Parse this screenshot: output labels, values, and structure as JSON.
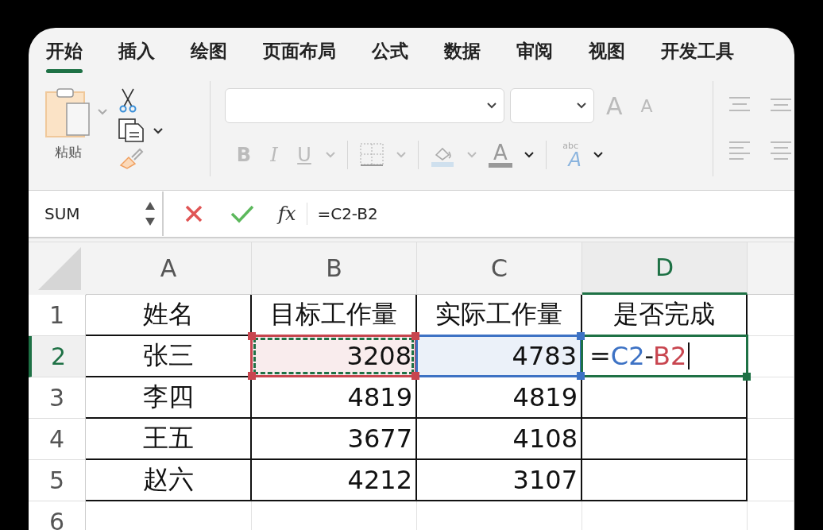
{
  "tabs": [
    {
      "label": "开始",
      "selected": true
    },
    {
      "label": "插入",
      "selected": false
    },
    {
      "label": "绘图",
      "selected": false
    },
    {
      "label": "页面布局",
      "selected": false
    },
    {
      "label": "公式",
      "selected": false
    },
    {
      "label": "数据",
      "selected": false
    },
    {
      "label": "审阅",
      "selected": false
    },
    {
      "label": "视图",
      "selected": false
    },
    {
      "label": "开发工具",
      "selected": false
    }
  ],
  "clipboard": {
    "paste_label": "粘贴"
  },
  "font_buttons": [
    {
      "kind": "bold",
      "glyph": "B"
    },
    {
      "kind": "italic",
      "glyph": "I"
    },
    {
      "kind": "underline",
      "glyph": "U"
    }
  ],
  "font_color": {
    "glyph": "A"
  },
  "text_effects": {
    "small": "abc",
    "glyph": "A"
  },
  "grow_shrink": [
    {
      "glyph": "A",
      "kind": "grow"
    },
    {
      "glyph": "A",
      "kind": "shrink"
    }
  ],
  "formula_bar": {
    "name_box": "SUM",
    "fx": "fx",
    "formula": "=C2-B2"
  },
  "columns": [
    {
      "label": "A",
      "selected": false
    },
    {
      "label": "B",
      "selected": false
    },
    {
      "label": "C",
      "selected": false
    },
    {
      "label": "D",
      "selected": true
    }
  ],
  "rows": [
    {
      "number": "1",
      "selected": false,
      "cells": [
        {
          "text": "姓名",
          "kind": "label"
        },
        {
          "text": "目标工作量",
          "kind": "label"
        },
        {
          "text": "实际工作量",
          "kind": "label"
        },
        {
          "text": "是否完成",
          "kind": "label"
        }
      ]
    },
    {
      "number": "2",
      "selected": true,
      "cells": [
        {
          "text": "张三",
          "kind": "label"
        },
        {
          "text": "3208",
          "kind": "reference",
          "color": "#c8454f",
          "marquee": true
        },
        {
          "text": "4783",
          "kind": "reference",
          "color": "#3d72c4",
          "marquee": false
        },
        {
          "kind": "editing",
          "tokens": [
            {
              "text": "=",
              "color": "#222222"
            },
            {
              "text": "C2",
              "color": "#3d72c4"
            },
            {
              "text": "-",
              "color": "#222222"
            },
            {
              "text": "B2",
              "color": "#c8454f"
            }
          ]
        }
      ]
    },
    {
      "number": "3",
      "selected": false,
      "cells": [
        {
          "text": "李四",
          "kind": "label"
        },
        {
          "text": "4819",
          "kind": "number"
        },
        {
          "text": "4819",
          "kind": "number"
        },
        {}
      ]
    },
    {
      "number": "4",
      "selected": false,
      "cells": [
        {
          "text": "王五",
          "kind": "label"
        },
        {
          "text": "3677",
          "kind": "number"
        },
        {
          "text": "4108",
          "kind": "number"
        },
        {}
      ]
    },
    {
      "number": "5",
      "selected": false,
      "cells": [
        {
          "text": "赵六",
          "kind": "label"
        },
        {
          "text": "4212",
          "kind": "number"
        },
        {
          "text": "3107",
          "kind": "number"
        },
        {}
      ]
    },
    {
      "number": "6",
      "selected": false,
      "cells": []
    }
  ]
}
